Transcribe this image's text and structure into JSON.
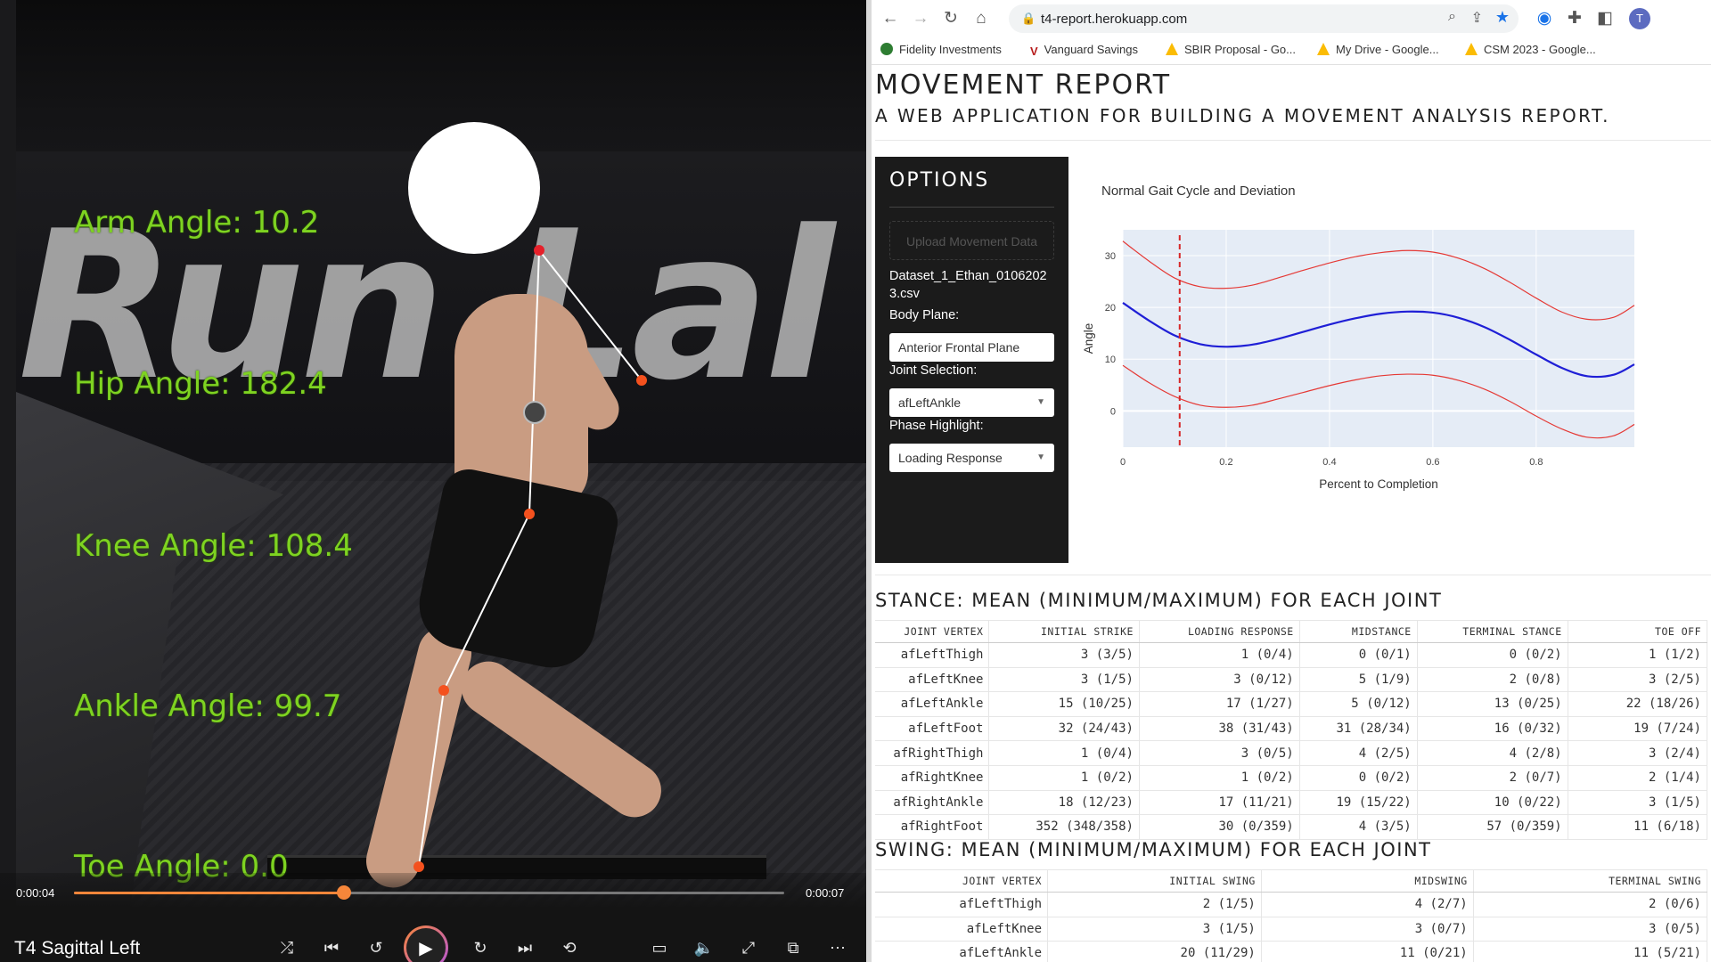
{
  "video": {
    "overlay_color": "#7ed321",
    "joint_color": "#f4511e",
    "labels": {
      "arm": "Arm Angle: 10.2",
      "hip": "Hip Angle: 182.4",
      "knee": "Knee Angle: 108.4",
      "ankle": "Ankle Angle: 99.7",
      "toe": "Toe Angle: 0.0"
    },
    "wall_text": "Run Lal",
    "player": {
      "current_time": "0:00:04",
      "total_time": "0:00:07",
      "progress": 0.38,
      "title": "T4 Sagittal Left",
      "accent": "#f6863a",
      "controls": [
        "shuffle-icon",
        "previous-icon",
        "rewind-10-icon",
        "play-icon",
        "forward-30-icon",
        "next-icon",
        "repeat-off-icon",
        "captions-icon",
        "volume-icon",
        "fullscreen-icon",
        "miniplayer-icon",
        "more-icon"
      ]
    }
  },
  "browser": {
    "url": "t4-report.herokuapp.com",
    "bookmarks": [
      {
        "label": "Fidelity Investments",
        "color": "#2e7d32"
      },
      {
        "label": "Vanguard Savings",
        "color": "#b71c1c"
      },
      {
        "label": "SBIR Proposal - Go...",
        "color": "#fbbc04"
      },
      {
        "label": "My Drive - Google...",
        "color": "#fbbc04"
      },
      {
        "label": "CSM 2023 - Google...",
        "color": "#fbbc04"
      }
    ],
    "profile_initial": "T"
  },
  "page": {
    "title": "MOVEMENT REPORT",
    "subtitle": "A WEB APPLICATION FOR BUILDING A MOVEMENT ANALYSIS REPORT."
  },
  "options": {
    "heading": "OPTIONS",
    "upload_label": "Upload Movement Data",
    "filename": "Dataset_1_Ethan_01062023.csv",
    "body_plane_label": "Body Plane:",
    "body_plane_value": "Anterior Frontal Plane",
    "joint_label": "Joint Selection:",
    "joint_value": "afLeftAnkle",
    "phase_label": "Phase Highlight:",
    "phase_value": "Loading Response"
  },
  "chart_data": {
    "type": "line",
    "title": "Normal Gait Cycle and Deviation",
    "xlabel": "Percent to Completion",
    "ylabel": "Angle",
    "xlim": [
      0,
      0.99
    ],
    "ylim": [
      -7,
      35
    ],
    "xticks": [
      0,
      0.2,
      0.4,
      0.6,
      0.8
    ],
    "xtick_labels": [
      "0",
      "0.2",
      "0.4",
      "0.6",
      "0.8"
    ],
    "yticks": [
      0,
      10,
      20,
      30
    ],
    "yticks_labels": [
      "0",
      "10",
      "20",
      "30"
    ],
    "grid": true,
    "highlight_x": 0.11,
    "highlight_color": "#d62728",
    "x": [
      0,
      0.05,
      0.1,
      0.15,
      0.2,
      0.25,
      0.3,
      0.35,
      0.4,
      0.45,
      0.5,
      0.55,
      0.6,
      0.65,
      0.7,
      0.75,
      0.8,
      0.85,
      0.9,
      0.95,
      0.99
    ],
    "series": [
      {
        "color": "#1f1fd6",
        "values": [
          20.9,
          17.5,
          14.6,
          12.9,
          12.4,
          12.8,
          13.9,
          15.3,
          16.7,
          17.9,
          18.8,
          19.2,
          19.0,
          18.0,
          16.2,
          13.7,
          10.9,
          8.3,
          6.7,
          7.0,
          9.0
        ]
      },
      {
        "color": "#e53935",
        "values": [
          32.8,
          29.0,
          25.7,
          24.0,
          23.7,
          24.3,
          25.7,
          27.2,
          28.6,
          29.8,
          30.6,
          31.0,
          30.7,
          29.5,
          27.5,
          24.8,
          21.8,
          19.1,
          17.7,
          18.1,
          20.4
        ]
      },
      {
        "color": "#e53935",
        "values": [
          8.8,
          5.5,
          2.8,
          1.1,
          0.7,
          1.1,
          2.3,
          3.6,
          4.9,
          6.0,
          6.8,
          7.1,
          6.9,
          5.9,
          4.2,
          1.8,
          -1.0,
          -3.5,
          -5.1,
          -4.8,
          -2.6
        ]
      }
    ]
  },
  "stance": {
    "title": "STANCE: MEAN (MINIMUM/MAXIMUM) FOR EACH JOINT",
    "headers": [
      "JOINT VERTEX",
      "INITIAL STRIKE",
      "LOADING RESPONSE",
      "MIDSTANCE",
      "TERMINAL STANCE",
      "TOE OFF"
    ],
    "rows": [
      [
        "afLeftThigh",
        "3 (3/5)",
        "1 (0/4)",
        "0 (0/1)",
        "0 (0/2)",
        "1 (1/2)"
      ],
      [
        "afLeftKnee",
        "3 (1/5)",
        "3 (0/12)",
        "5 (1/9)",
        "2 (0/8)",
        "3 (2/5)"
      ],
      [
        "afLeftAnkle",
        "15 (10/25)",
        "17 (1/27)",
        "5 (0/12)",
        "13 (0/25)",
        "22 (18/26)"
      ],
      [
        "afLeftFoot",
        "32 (24/43)",
        "38 (31/43)",
        "31 (28/34)",
        "16 (0/32)",
        "19 (7/24)"
      ],
      [
        "afRightThigh",
        "1 (0/4)",
        "3 (0/5)",
        "4 (2/5)",
        "4 (2/8)",
        "3 (2/4)"
      ],
      [
        "afRightKnee",
        "1 (0/2)",
        "1 (0/2)",
        "0 (0/2)",
        "2 (0/7)",
        "2 (1/4)"
      ],
      [
        "afRightAnkle",
        "18 (12/23)",
        "17 (11/21)",
        "19 (15/22)",
        "10 (0/22)",
        "3 (1/5)"
      ],
      [
        "afRightFoot",
        "352 (348/358)",
        "30 (0/359)",
        "4 (3/5)",
        "57 (0/359)",
        "11 (6/18)"
      ]
    ]
  },
  "swing": {
    "title": "SWING: MEAN (MINIMUM/MAXIMUM) FOR EACH JOINT",
    "headers": [
      "JOINT VERTEX",
      "INITIAL SWING",
      "MIDSWING",
      "TERMINAL SWING"
    ],
    "rows": [
      [
        "afLeftThigh",
        "2 (1/5)",
        "4 (2/7)",
        "2 (0/6)"
      ],
      [
        "afLeftKnee",
        "3 (1/5)",
        "3 (0/7)",
        "3 (0/5)"
      ],
      [
        "afLeftAnkle",
        "20 (11/29)",
        "11 (0/21)",
        "11 (5/21)"
      ]
    ]
  }
}
